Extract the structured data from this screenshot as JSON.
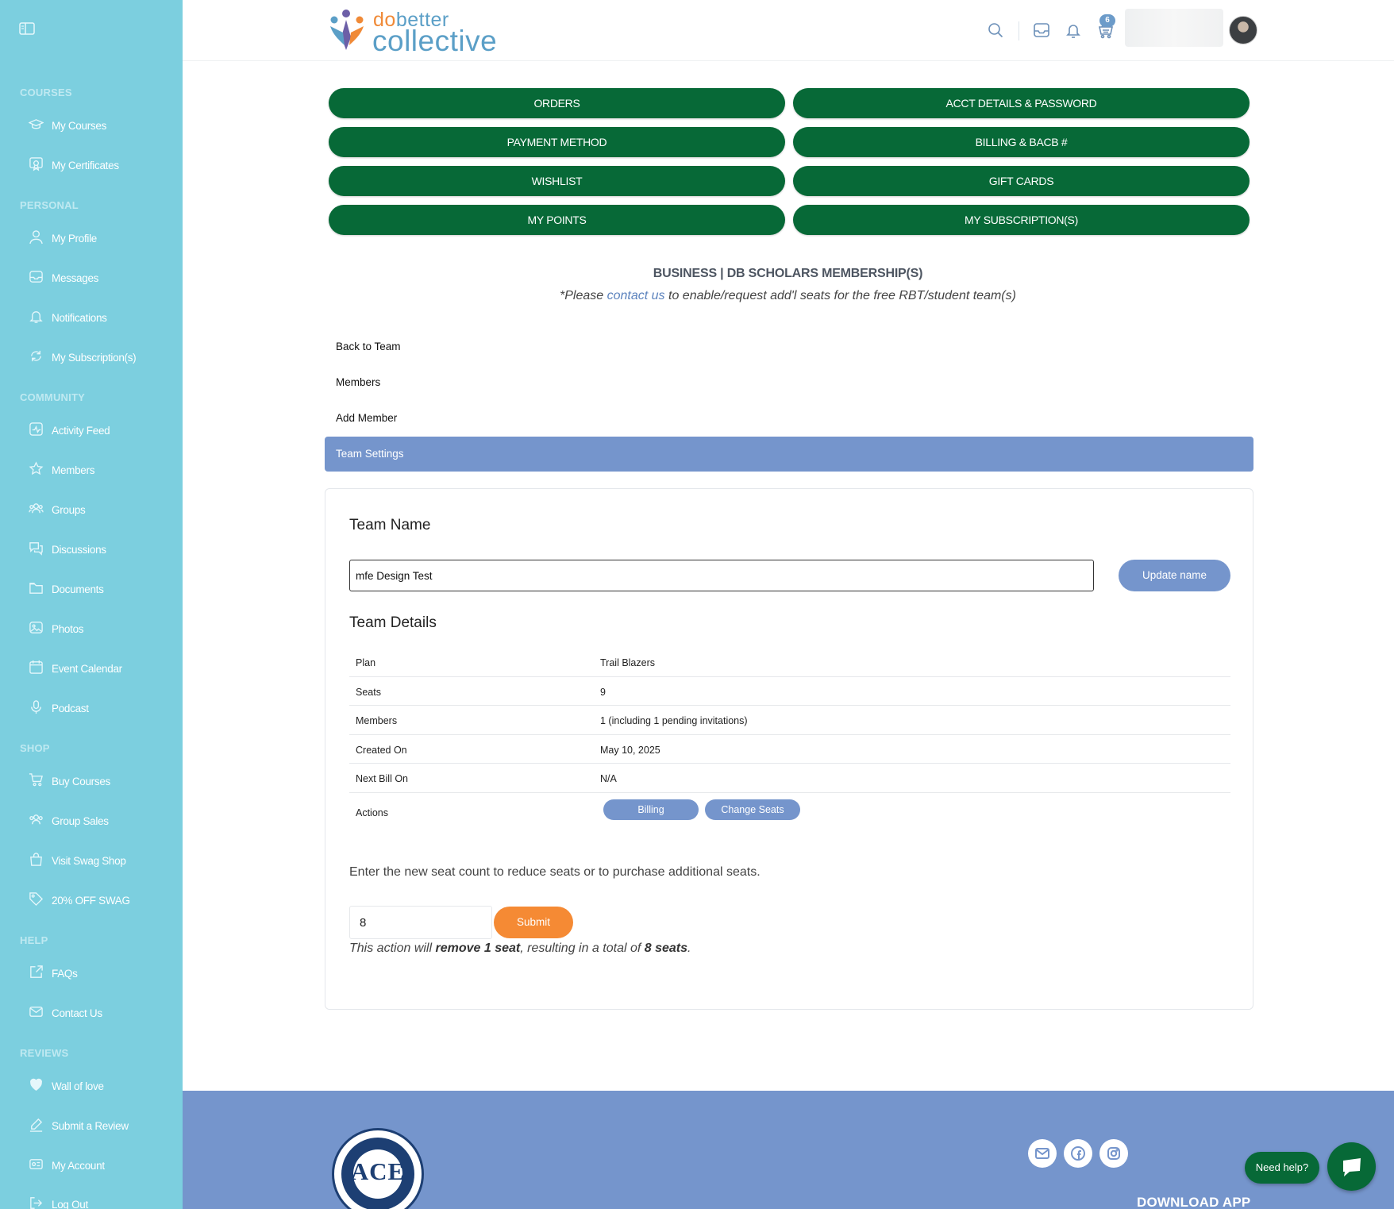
{
  "sidebar": {
    "sections": [
      {
        "title": "COURSES",
        "items": [
          {
            "label": "My Courses",
            "icon": "graduation-cap-icon"
          },
          {
            "label": "My Certificates",
            "icon": "certificate-icon"
          }
        ]
      },
      {
        "title": "PERSONAL",
        "items": [
          {
            "label": "My Profile",
            "icon": "user-icon"
          },
          {
            "label": "Messages",
            "icon": "inbox-icon"
          },
          {
            "label": "Notifications",
            "icon": "bell-icon"
          },
          {
            "label": "My Subscription(s)",
            "icon": "refresh-icon"
          }
        ]
      },
      {
        "title": "COMMUNITY",
        "items": [
          {
            "label": "Activity Feed",
            "icon": "activity-icon"
          },
          {
            "label": "Members",
            "icon": "star-icon"
          },
          {
            "label": "Groups",
            "icon": "group-icon"
          },
          {
            "label": "Discussions",
            "icon": "chat-bubbles-icon"
          },
          {
            "label": "Documents",
            "icon": "folder-icon"
          },
          {
            "label": "Photos",
            "icon": "image-icon"
          },
          {
            "label": "Event Calendar",
            "icon": "calendar-icon"
          },
          {
            "label": "Podcast",
            "icon": "microphone-icon"
          }
        ]
      },
      {
        "title": "SHOP",
        "items": [
          {
            "label": "Buy Courses",
            "icon": "cart-icon"
          },
          {
            "label": "Group Sales",
            "icon": "group-icon"
          },
          {
            "label": "Visit Swag Shop",
            "icon": "bag-icon"
          },
          {
            "label": "20% OFF SWAG",
            "icon": "tag-icon"
          }
        ]
      },
      {
        "title": "HELP",
        "items": [
          {
            "label": "FAQs",
            "icon": "external-link-icon"
          },
          {
            "label": "Contact Us",
            "icon": "envelope-icon"
          }
        ]
      },
      {
        "title": "REVIEWS",
        "items": [
          {
            "label": "Wall of love",
            "icon": "heart-icon"
          },
          {
            "label": "Submit a Review",
            "icon": "pencil-icon"
          },
          {
            "label": "My Account",
            "icon": "id-card-icon"
          },
          {
            "label": "Log Out",
            "icon": "logout-icon"
          }
        ]
      }
    ]
  },
  "header": {
    "logo_do": "do",
    "logo_better": "better",
    "logo_collective": "collective",
    "cart_count": "6"
  },
  "account_buttons": [
    "ORDERS",
    "ACCT DETAILS & PASSWORD",
    "PAYMENT METHOD",
    "BILLING & BACB #",
    "WISHLIST",
    "GIFT CARDS",
    "MY POINTS",
    "MY SUBSCRIPTION(S)"
  ],
  "membership": {
    "title": "BUSINESS | DB SCHOLARS MEMBERSHIP(S)",
    "note_before": "*Please ",
    "note_link": "contact us",
    "note_after": " to enable/request add'l seats for the free RBT/student team(s)"
  },
  "subnav": {
    "back": "Back to Team",
    "members": "Members",
    "add_member": "Add Member",
    "active": "Team Settings"
  },
  "team": {
    "name_heading": "Team Name",
    "name_value": "mfe Design Test",
    "update_button": "Update name",
    "details_heading": "Team Details",
    "details": [
      {
        "label": "Plan",
        "value": "Trail Blazers"
      },
      {
        "label": "Seats",
        "value": "9"
      },
      {
        "label": "Members",
        "value": "1 (including 1 pending invitations)"
      },
      {
        "label": "Created On",
        "value": "May 10, 2025"
      },
      {
        "label": "Next Bill On",
        "value": "N/A"
      }
    ],
    "actions_label": "Actions",
    "billing_button": "Billing",
    "change_seats_button": "Change Seats",
    "seat_instructions": "Enter the new seat count to reduce seats or to purchase additional seats.",
    "seat_value": "8",
    "submit_button": "Submit",
    "result_prefix": "This action will ",
    "result_action": "remove 1 seat",
    "result_middle": ", resulting in a total of ",
    "result_total": "8 seats",
    "result_suffix": "."
  },
  "footer": {
    "ace_text": "ACE",
    "download_app": "DOWNLOAD APP",
    "need_help": "Need help?"
  },
  "colors": {
    "sidebar_bg": "#7ccfdf",
    "button_green": "#076937",
    "accent_blue": "#7595cc",
    "submit_orange": "#f58a34"
  }
}
